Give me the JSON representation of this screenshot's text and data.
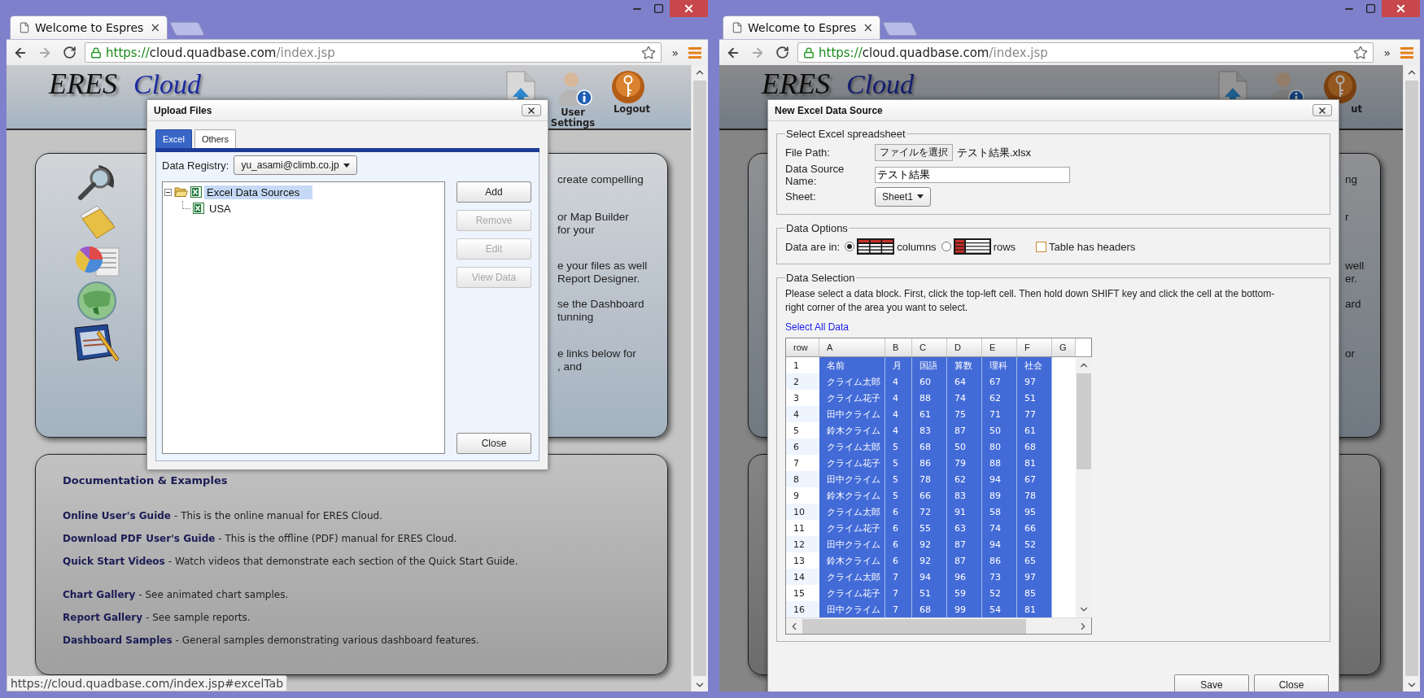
{
  "windows": [
    {
      "tab": {
        "title": "Welcome to Espres",
        "close": "×"
      },
      "address": {
        "scheme": "https://",
        "host": "cloud.quadbase.com",
        "path": "/index.jsp",
        "overflow": "»"
      },
      "page": {
        "dimmed": false,
        "logo": {
          "first": "ERES",
          "second": "Cloud"
        },
        "tools": [
          {
            "kind": "upload"
          },
          {
            "kind": "user",
            "label": "User Settings"
          },
          {
            "kind": "logout",
            "label": "Logout"
          }
        ],
        "intro": [
          [
            "create compelling"
          ],
          [
            "or Map Builder",
            "for your"
          ],
          [
            "e your files as well",
            "Report Designer."
          ],
          [
            "se the Dashboard",
            "tunning"
          ],
          [
            "e links below for",
            ", and"
          ]
        ],
        "docs": {
          "title": "Documentation & Examples",
          "groups": [
            [
              {
                "link": "Online User's Guide",
                "text": "- This is the online manual for ERES Cloud."
              },
              {
                "link": "Download PDF User's Guide",
                "text": "- This is the offline (PDF) manual for ERES Cloud."
              },
              {
                "link": "Quick Start Videos",
                "text": "- Watch videos that demonstrate each section of the Quick Start Guide."
              }
            ],
            [
              {
                "link": "Chart Gallery",
                "text": "- See animated chart samples."
              },
              {
                "link": "Report Gallery",
                "text": "- See sample reports."
              },
              {
                "link": "Dashboard Samples",
                "text": "- General samples demonstrating various dashboard features."
              }
            ]
          ]
        }
      },
      "dialog": {
        "kind": "upload",
        "title": "Upload Files",
        "tabs": [
          {
            "label": "Excel",
            "selected": true
          },
          {
            "label": "Others",
            "selected": false
          }
        ],
        "registry": {
          "label": "Data Registry:",
          "value": "yu_asami@climb.co.jp"
        },
        "tree": [
          {
            "label": "Excel Data Sources",
            "selected": true,
            "expanded": true,
            "children": [
              {
                "label": "USA",
                "selected": false
              }
            ]
          }
        ],
        "buttons": [
          {
            "label": "Add",
            "disabled": false
          },
          {
            "label": "Remove",
            "disabled": true
          },
          {
            "label": "Edit",
            "disabled": true
          },
          {
            "label": "View Data",
            "disabled": true
          }
        ],
        "close_button": "Close"
      },
      "status_url": "https://cloud.quadbase.com/index.jsp#excelTab"
    },
    {
      "tab": {
        "title": "Welcome to Espres",
        "close": "×"
      },
      "address": {
        "scheme": "https://",
        "host": "cloud.quadbase.com",
        "path": "/index.jsp",
        "overflow": "»"
      },
      "page": {
        "dimmed": true,
        "logo": {
          "first": "ERES",
          "second": "Cloud"
        },
        "tools": [
          {
            "kind": "upload"
          },
          {
            "kind": "user"
          },
          {
            "kind": "logout",
            "label": "ut"
          }
        ],
        "intro": [
          [
            "ng"
          ],
          [
            "r"
          ],
          [
            "well",
            "er."
          ],
          [
            "ard"
          ],
          [
            "or"
          ]
        ]
      },
      "dialog": {
        "kind": "excel_source",
        "title": "New Excel Data Source",
        "spreadsheet": {
          "legend": "Select Excel spreadsheet",
          "file_label": "File Path:",
          "file_button": "ファイルを選択",
          "file_name": "テスト結果.xlsx",
          "name_label": "Data Source Name:",
          "name_value": "テスト結果",
          "sheet_label": "Sheet:",
          "sheet_value": "Sheet1"
        },
        "options": {
          "legend": "Data Options",
          "label": "Data are in:",
          "layouts": [
            {
              "kind": "columns",
              "label": "columns",
              "selected": true
            },
            {
              "kind": "rows",
              "label": "rows",
              "selected": false
            }
          ],
          "headers": {
            "label": "Table has headers",
            "checked": false
          }
        },
        "selection": {
          "legend": "Data Selection",
          "instructions": "Please select a data block. First, click the top-left cell. Then hold down SHIFT key and click the cell at the bottom-right corner of the area you want to select.",
          "select_all": "Select All Data",
          "columns": [
            {
              "label": "row"
            },
            {
              "label": "A"
            },
            {
              "label": "B"
            },
            {
              "label": "C"
            },
            {
              "label": "D"
            },
            {
              "label": "E"
            },
            {
              "label": "F"
            },
            {
              "label": "G"
            }
          ],
          "rows": [
            {
              "selected": true,
              "cells": [
                "1",
                "名前",
                "月",
                "国語",
                "算数",
                "理科",
                "社会"
              ]
            },
            {
              "selected": true,
              "cells": [
                "2",
                "クライム太郎",
                "4",
                "60",
                "64",
                "67",
                "97"
              ]
            },
            {
              "selected": true,
              "cells": [
                "3",
                "クライム花子",
                "4",
                "88",
                "74",
                "62",
                "51"
              ]
            },
            {
              "selected": true,
              "cells": [
                "4",
                "田中クライム",
                "4",
                "61",
                "75",
                "71",
                "77"
              ]
            },
            {
              "selected": true,
              "cells": [
                "5",
                "鈴木クライム",
                "4",
                "83",
                "87",
                "50",
                "61"
              ]
            },
            {
              "selected": true,
              "cells": [
                "6",
                "クライム太郎",
                "5",
                "68",
                "50",
                "80",
                "68"
              ]
            },
            {
              "selected": true,
              "cells": [
                "7",
                "クライム花子",
                "5",
                "86",
                "79",
                "88",
                "81"
              ]
            },
            {
              "selected": true,
              "cells": [
                "8",
                "田中クライム",
                "5",
                "78",
                "62",
                "94",
                "67"
              ]
            },
            {
              "selected": true,
              "cells": [
                "9",
                "鈴木クライム",
                "5",
                "66",
                "83",
                "89",
                "78"
              ]
            },
            {
              "selected": true,
              "cells": [
                "10",
                "クライム太郎",
                "6",
                "72",
                "91",
                "58",
                "95"
              ]
            },
            {
              "selected": true,
              "cells": [
                "11",
                "クライム花子",
                "6",
                "55",
                "63",
                "74",
                "66"
              ]
            },
            {
              "selected": true,
              "cells": [
                "12",
                "田中クライム",
                "6",
                "92",
                "87",
                "94",
                "52"
              ]
            },
            {
              "selected": true,
              "cells": [
                "13",
                "鈴木クライム",
                "6",
                "92",
                "87",
                "86",
                "65"
              ]
            },
            {
              "selected": true,
              "cells": [
                "14",
                "クライム太郎",
                "7",
                "94",
                "96",
                "73",
                "97"
              ]
            },
            {
              "selected": true,
              "cells": [
                "15",
                "クライム花子",
                "7",
                "51",
                "59",
                "52",
                "85"
              ]
            },
            {
              "selected": true,
              "cells": [
                "16",
                "田中クライム",
                "7",
                "68",
                "99",
                "54",
                "81"
              ]
            }
          ]
        },
        "buttons": [
          {
            "label": "Save"
          },
          {
            "label": "Close"
          }
        ]
      }
    }
  ]
}
